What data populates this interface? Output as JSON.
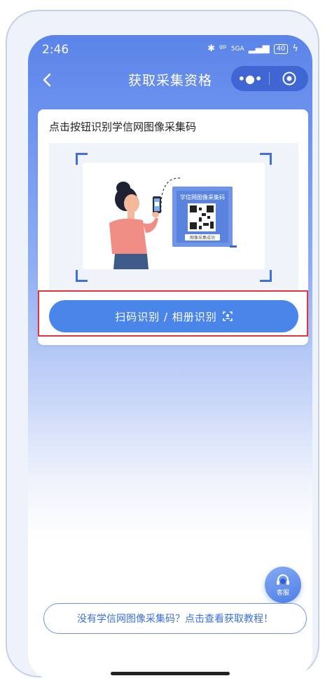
{
  "status_bar": {
    "time": "2:46",
    "network": "5GA",
    "battery": "40"
  },
  "nav": {
    "title": "获取采集资格",
    "back_icon": "chevron-left-icon",
    "more_label": "•●•",
    "close_icon": "target-icon"
  },
  "card": {
    "title": "点击按钮识别学信网图像采集码",
    "illustration": {
      "sign_title": "学信网图像采集码",
      "sign_caption": "图像采集成功"
    },
    "scan_button_label": "扫码识别 / 相册识别",
    "scan_icon": "scan-frame-icon"
  },
  "service": {
    "label": "客服",
    "icon": "headset-icon"
  },
  "tutorial_link": "没有学信网图像采集码？点击查看获取教程！",
  "colors": {
    "primary": "#4a86ea",
    "header": "#5b84e9",
    "highlight": "#e8333a"
  }
}
